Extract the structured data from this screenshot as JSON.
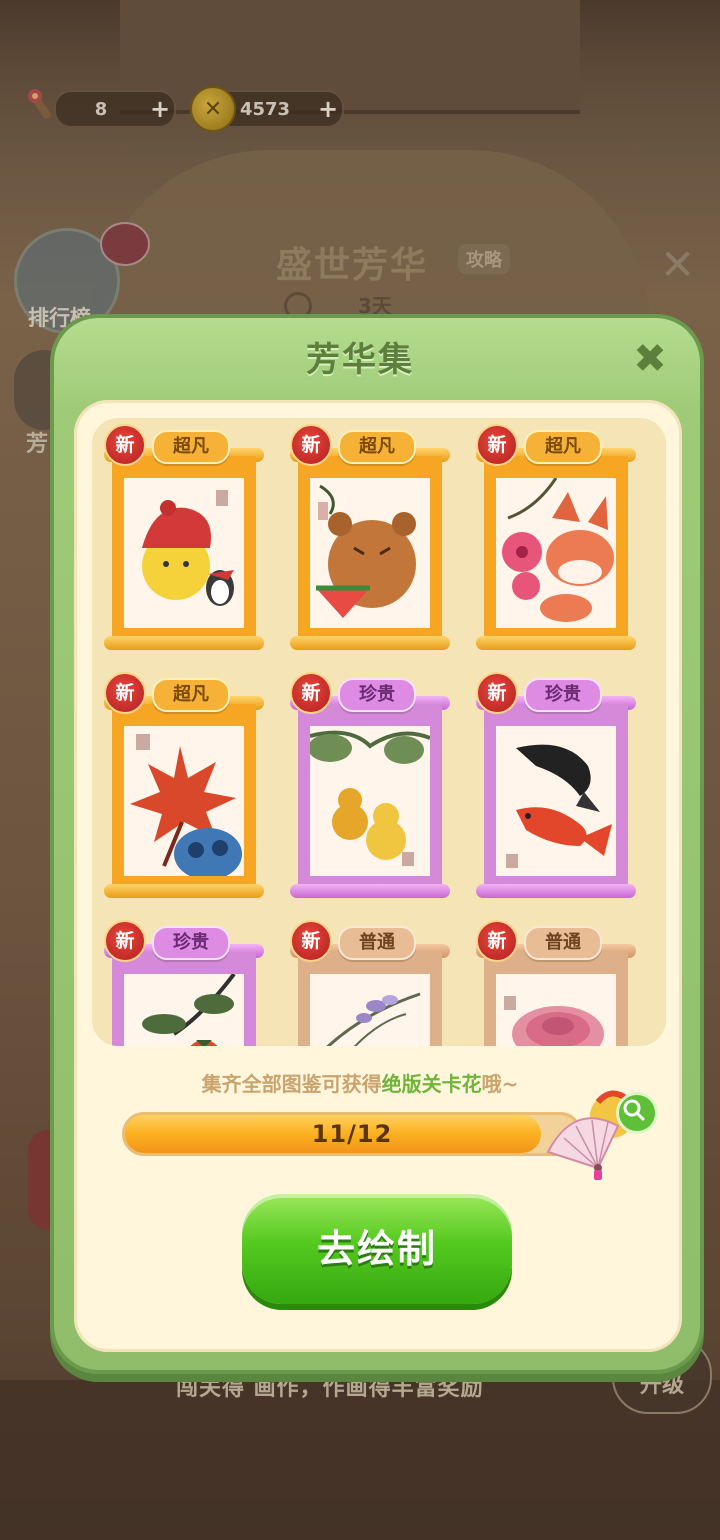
{
  "topbar": {
    "torches": {
      "icon": "torch-icon",
      "value": "8",
      "plus": "+"
    },
    "coins": {
      "icon": "coin-icon",
      "symbol": "✕",
      "value": "4573",
      "plus": "+"
    }
  },
  "background": {
    "event_title": "盛世芳华",
    "guide_label": "攻略",
    "days_left": "3天",
    "rank_label": "排行榜",
    "fang_label": "芳",
    "bottom_text": "闯关得 画作，作画得丰富奖励",
    "upgrade_label": "升级"
  },
  "modal": {
    "title": "芳华集",
    "close_symbol": "✖",
    "cards": [
      {
        "new": "新",
        "rarity": "超凡",
        "rarity_key": "super",
        "art": "chick-in-hat"
      },
      {
        "new": "新",
        "rarity": "超凡",
        "rarity_key": "super",
        "art": "bear-watermelon"
      },
      {
        "new": "新",
        "rarity": "超凡",
        "rarity_key": "super",
        "art": "fox-plum-blossom"
      },
      {
        "new": "新",
        "rarity": "超凡",
        "rarity_key": "super",
        "art": "maple-leaf"
      },
      {
        "new": "新",
        "rarity": "珍贵",
        "rarity_key": "rare",
        "art": "gourds"
      },
      {
        "new": "新",
        "rarity": "珍贵",
        "rarity_key": "rare",
        "art": "koi-fish"
      },
      {
        "new": "新",
        "rarity": "珍贵",
        "rarity_key": "rare",
        "art": "persimmons"
      },
      {
        "new": "新",
        "rarity": "普通",
        "rarity_key": "norm",
        "art": "orchid"
      },
      {
        "new": "新",
        "rarity": "普通",
        "rarity_key": "norm",
        "art": "chrysanthemum"
      }
    ],
    "hint_prefix": "集齐全部图鉴可获得",
    "hint_highlight": "绝版关卡花",
    "hint_suffix": "哦~",
    "progress": {
      "current": 11,
      "total": 12,
      "label": "11/12"
    },
    "reward_icon": "folding-fan-icon",
    "zoom_icon": "magnifier-icon",
    "go_button": "去绘制"
  },
  "colors": {
    "modal_green": "#9fcb78",
    "go_green": "#54c91f",
    "super_orange": "#f6a623",
    "rare_purple": "#d48ad8",
    "normal_tan": "#deb08a",
    "new_badge_red": "#c6292a"
  }
}
